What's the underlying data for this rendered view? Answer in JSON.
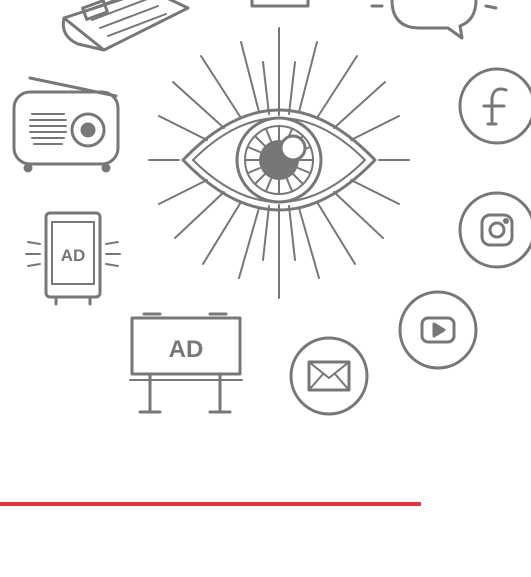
{
  "icons": {
    "poster_label": "AD",
    "billboard_label": "AD",
    "items": [
      "newspaper-icon",
      "tv-icon",
      "speech-bubble-icon",
      "radio-icon",
      "eye-icon",
      "facebook-icon",
      "instagram-icon",
      "poster-ad-icon",
      "billboard-ad-icon",
      "email-icon",
      "youtube-icon"
    ]
  },
  "colors": {
    "icon_stroke": "#777777",
    "accent_line": "#e8313d",
    "background": "#ffffff"
  }
}
